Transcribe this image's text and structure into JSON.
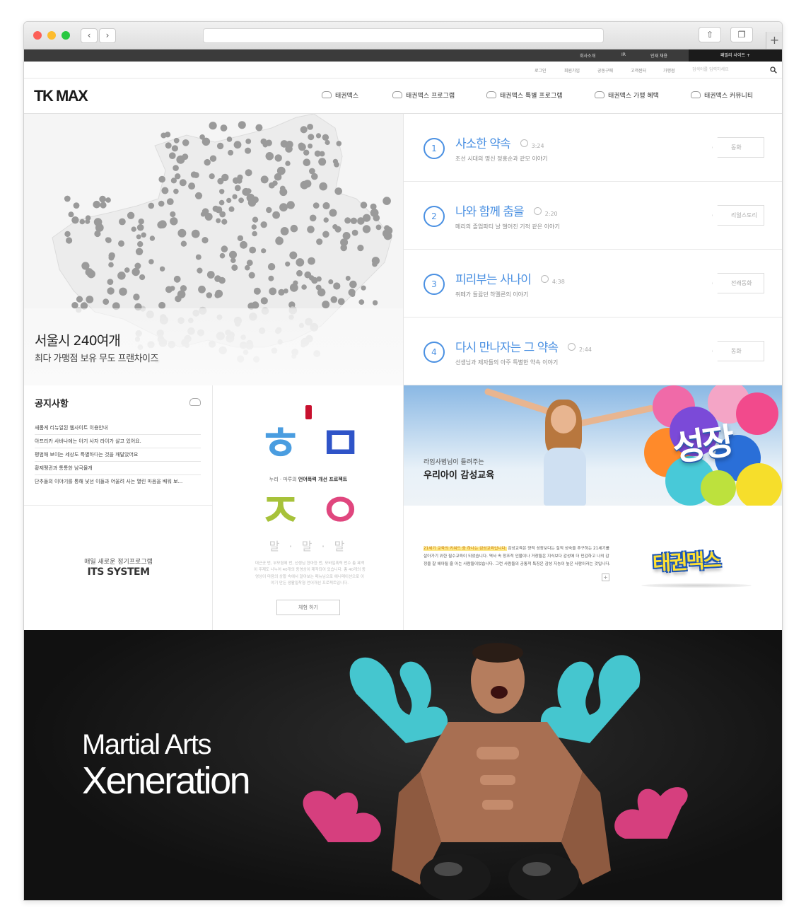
{
  "topbar": {
    "links": [
      "회사소개",
      "IR",
      "인재 채용"
    ],
    "family_site": "패밀리 사이트 +"
  },
  "util": {
    "links": [
      "로그인",
      "회원가입",
      "공동구매",
      "고객센터",
      "가맹점"
    ],
    "search_placeholder": "검색어를 입력하세요"
  },
  "header": {
    "logo": "TK MAX",
    "nav": [
      "태권맥스",
      "태권맥스 프로그램",
      "태권맥스 특별 프로그램",
      "태권맥스 가맹 혜택",
      "태권맥스 커뮤니티"
    ]
  },
  "map": {
    "title": "서울시 240여개",
    "subtitle": "최다 가맹점 보유 무도 프랜차이즈"
  },
  "stories": [
    {
      "num": "1",
      "title": "사소한 약속",
      "time": "3:24",
      "desc": "조선 시대의 명신 정홍순과 같모 이야기",
      "tag": "동화"
    },
    {
      "num": "2",
      "title": "나와 함께 춤을",
      "time": "2:20",
      "desc": "메리의 졸업파티 날 벌어진 기적 같은 이야기",
      "tag": "리얼스토리"
    },
    {
      "num": "3",
      "title": "피리부는 사나이",
      "time": "4:38",
      "desc": "쥐떼가 들끓던 하멜른의 이야기",
      "tag": "전래동화"
    },
    {
      "num": "4",
      "title": "다시 만나자는 그 약속",
      "time": "2:44",
      "desc": "선생님과 제자들의 아주 특별한 약속 이야기",
      "tag": "동화"
    }
  ],
  "notice": {
    "title": "공지사항",
    "items": [
      "새롭게 리뉴얼된 웹사이트 이용안내",
      "아프리카 사바나에는 아기 사자 라이가 살고 있어요.",
      "평범해 보이는 세상도 특별하다는 것을 깨달았어요",
      "황제펭귄과 통통한 남극물개",
      "단추들의 이야기를 통해 낯선 이들과 어울려 사는 열린 마음을 배워 보..."
    ]
  },
  "its": {
    "subtitle": "매일 새로운 정기프로그램",
    "title": "ITS SYSTEM"
  },
  "language": {
    "glyphs": [
      "ㅎ",
      "ㅁ",
      "ㅈ",
      "ㅇ"
    ],
    "caption_pre": "누리 · 마루의 ",
    "caption_bold": "언어폭력 개선 프로젝트",
    "malmal": "말 · 말 · 말",
    "description": "대근곳 번, 부모형제 번, 선생님 한마한 번, 모바일폭력 번수 총 욕백이 주제도 나누어 40개의 동영상이 제작되어 있습니다. 총 40개의 동영상이 마음의 상황 속에서 알아보는 매뉴님으로 애니메이션으로 이야기 만든 생활밀착형 언어개선 프로젝트입니다.",
    "button": "체험 하기"
  },
  "banner": {
    "subtitle": "라임사범님이 들려주는",
    "title": "우리아이 감성교육",
    "badge": "성장"
  },
  "education": {
    "highlight": "21세기 교육의 키워드 중 하나는 감성교육입니다.",
    "text": " 감성교육은 양적 성장보다는 질적 성숙을 추구하는 21세기를 살아가기 위한 필수교육이 되었습니다. 역사 속 창조적 인물이나 거장들은 지식보다 감성에 더 민감하고 나의 감정을 잘 헤아릴 줄 아는 사람들이었습니다. 그런 사람들의 공통적 특징은 감성 지능이 높은 사람이라는 것입니다.",
    "plus": "+",
    "logo": "태권맥스"
  },
  "hero": {
    "line1": "Martial Arts",
    "line2": "Xeneration"
  },
  "colors": {
    "accent_blue": "#4a90e2",
    "topbar": "#3b3b3b",
    "hero_bg": "#111111",
    "smoke_cyan": "#45c6cf",
    "smoke_pink": "#d63f7e"
  }
}
